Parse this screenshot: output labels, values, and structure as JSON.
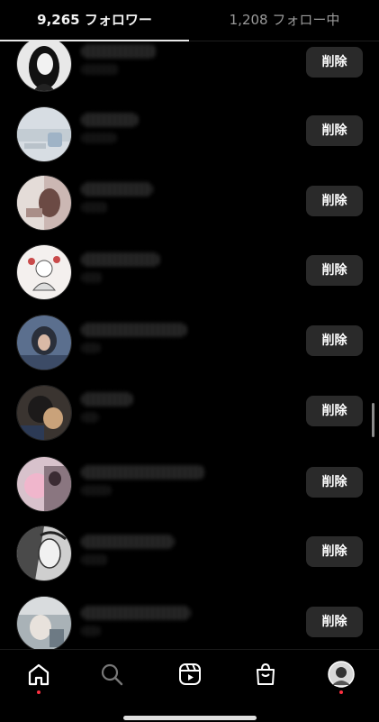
{
  "tabs": {
    "followers_label": "9,265 フォロワー",
    "following_label": "1,208 フォロー中"
  },
  "rows": [
    {
      "remove_label": "削除"
    },
    {
      "remove_label": "削除"
    },
    {
      "remove_label": "削除"
    },
    {
      "remove_label": "削除"
    },
    {
      "remove_label": "削除"
    },
    {
      "remove_label": "削除"
    },
    {
      "remove_label": "削除"
    },
    {
      "remove_label": "削除"
    },
    {
      "remove_label": "削除"
    }
  ],
  "navbar": {
    "items": [
      "home-icon",
      "search-icon",
      "reels-icon",
      "shop-icon",
      "profile-avatar"
    ],
    "notification_color": "#ff3040"
  },
  "colors": {
    "background": "#000000",
    "button_bg": "#2a2a2a",
    "tab_active": "#f2f2f2",
    "tab_inactive": "#9a9a9a"
  }
}
